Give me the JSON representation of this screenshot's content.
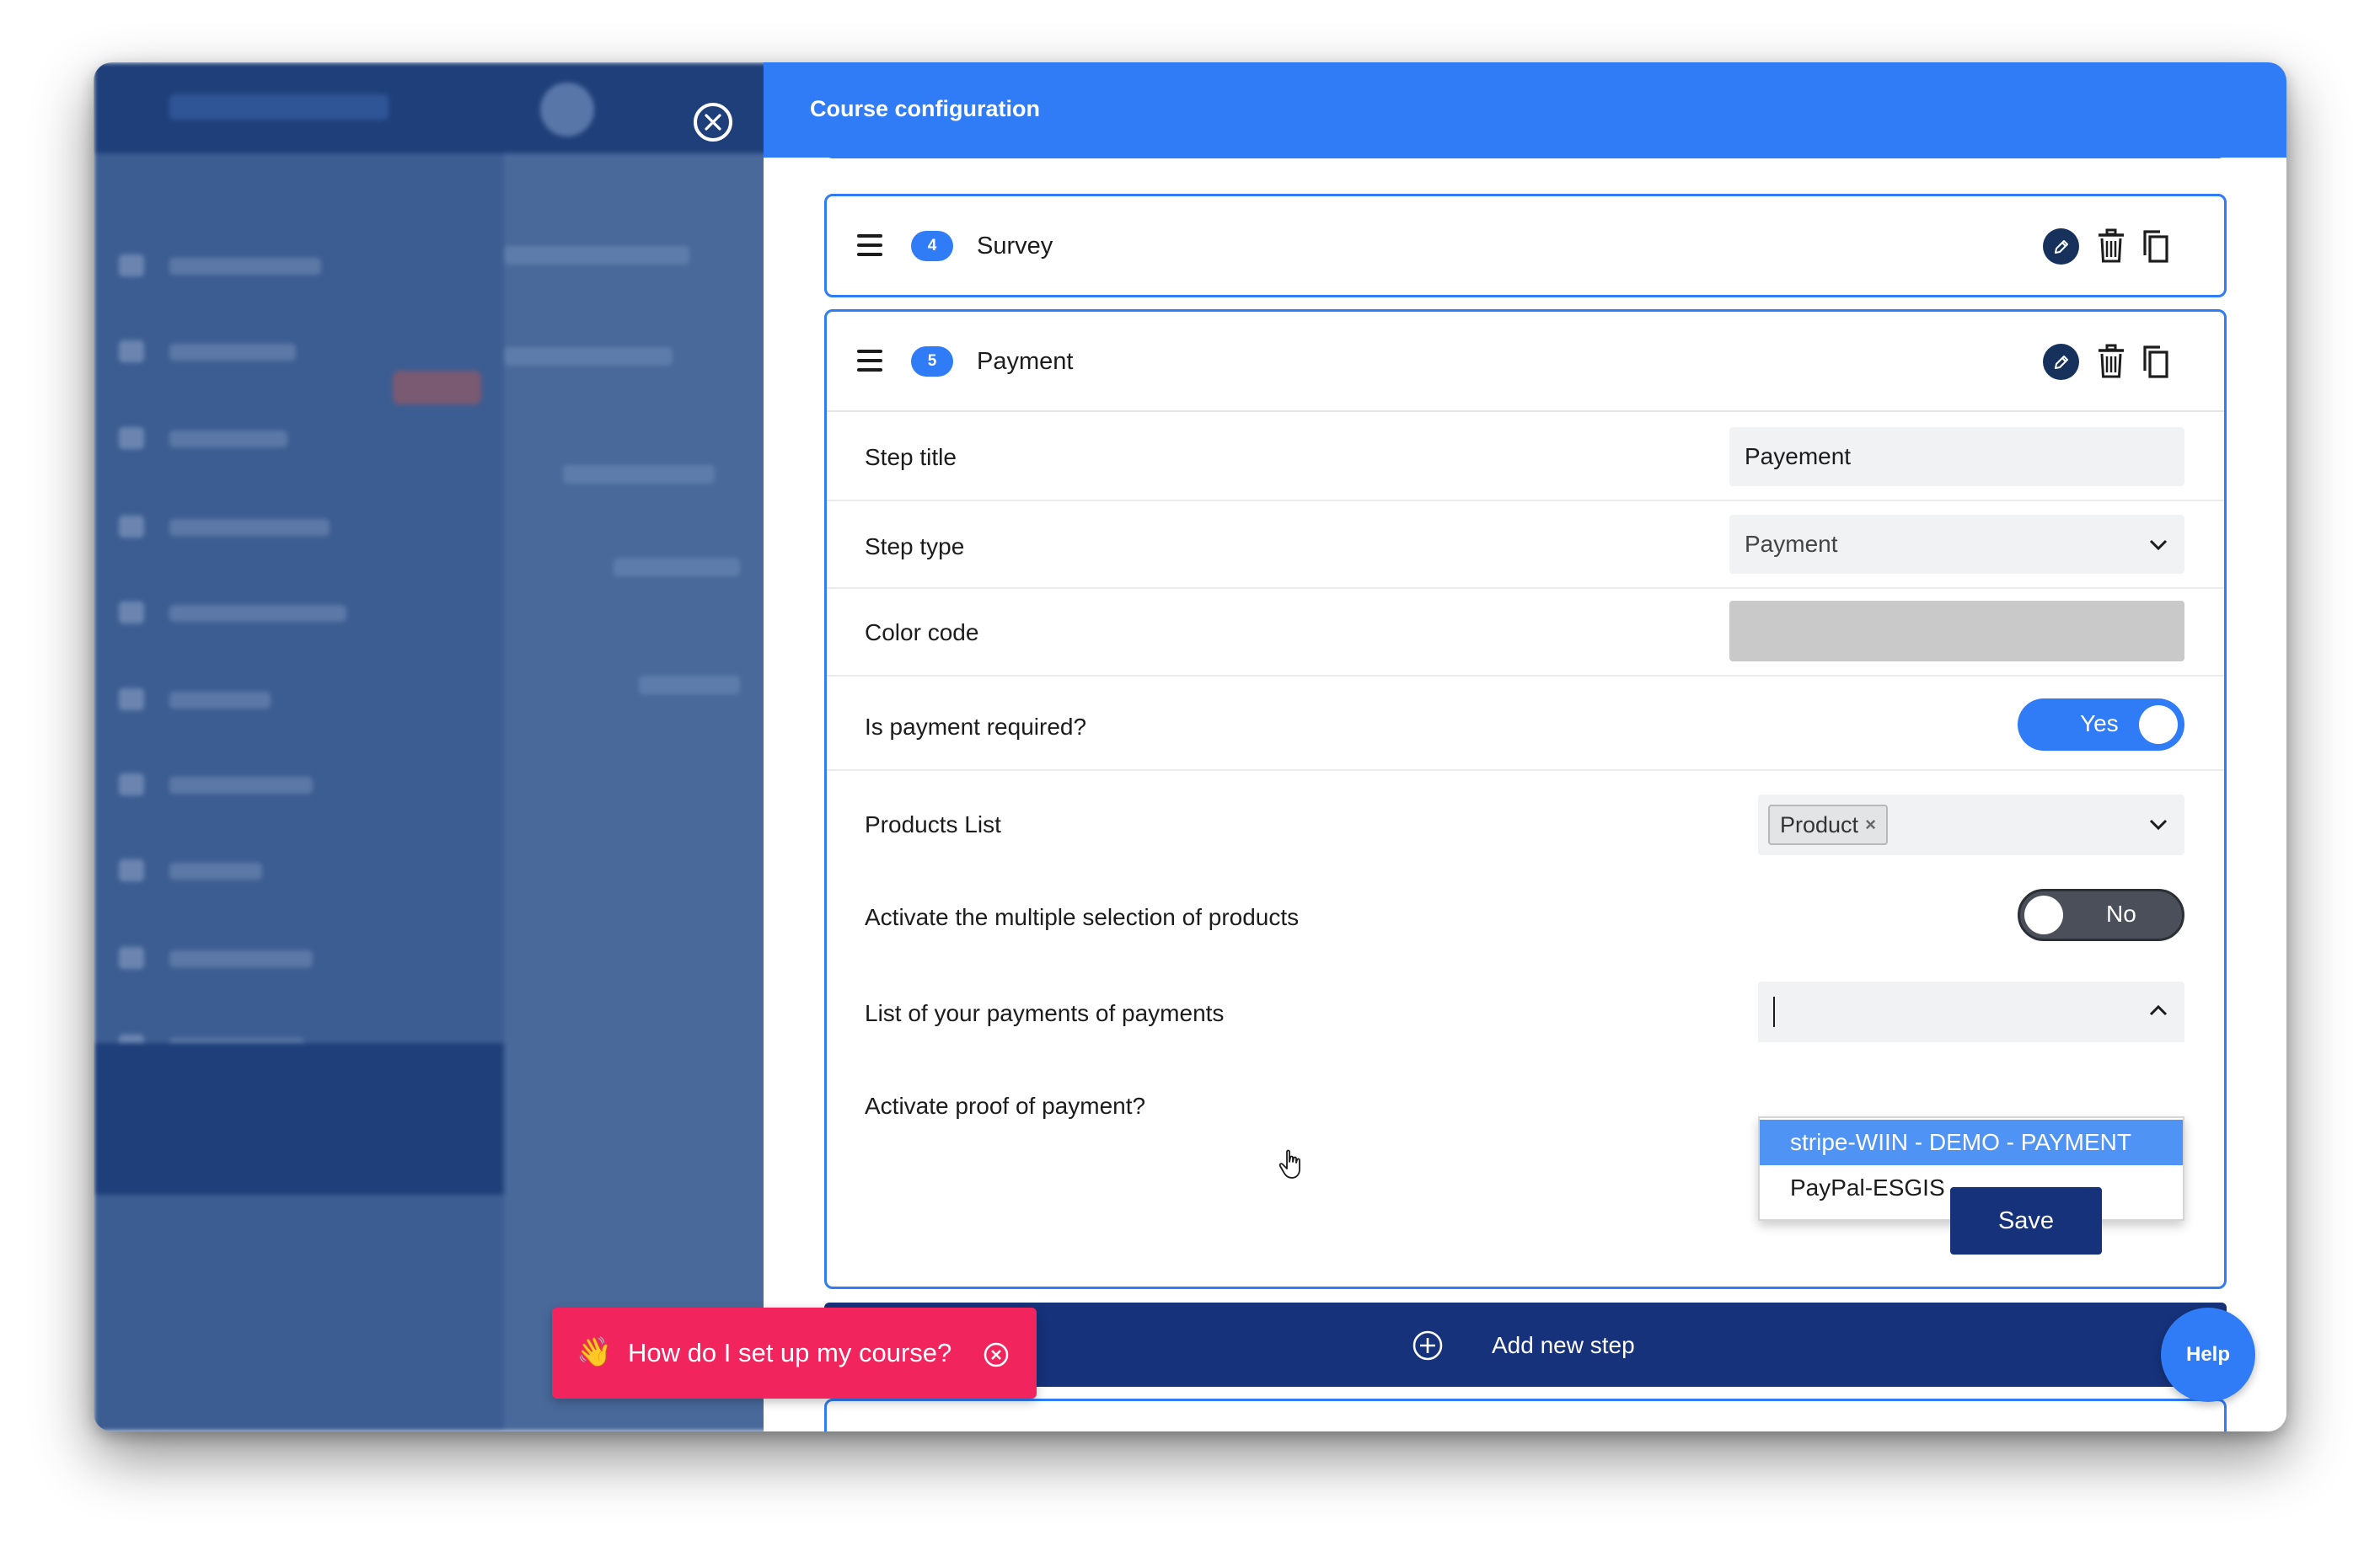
{
  "panel": {
    "title": "Course configuration",
    "close_icon": "close-circle-icon"
  },
  "steps": [
    {
      "number": "4",
      "name": "Survey"
    },
    {
      "number": "5",
      "name": "Payment"
    }
  ],
  "payment_form": {
    "step_title_label": "Step title",
    "step_title_value": "Payement",
    "step_type_label": "Step type",
    "step_type_value": "Payment",
    "color_code_label": "Color code",
    "color_code_value": "#c9c9c9",
    "payment_required_label": "Is payment required?",
    "payment_required_value": "Yes",
    "products_list_label": "Products List",
    "products_list_chip": "Product",
    "products_list_chip_remove": "×",
    "multiple_selection_label": "Activate the multiple selection of products",
    "multiple_selection_value": "No",
    "payments_list_label": "List of your payments of payments",
    "payments_list_options": [
      "stripe-WIIN - DEMO - PAYMENT",
      "PayPal-ESGIS"
    ],
    "payments_list_highlighted": "stripe-WIIN - DEMO - PAYMENT",
    "proof_of_payment_label": "Activate proof of payment?",
    "save_label": "Save"
  },
  "add_step": {
    "label": "Add new step"
  },
  "help": {
    "label": "Help"
  },
  "tip": {
    "emoji": "👋",
    "text": "How do I set up my course?"
  },
  "colors": {
    "primary": "#2f7cf6",
    "dark_navy": "#16327a",
    "tip_pink": "#f2245d",
    "highlight": "#4f93f5"
  }
}
